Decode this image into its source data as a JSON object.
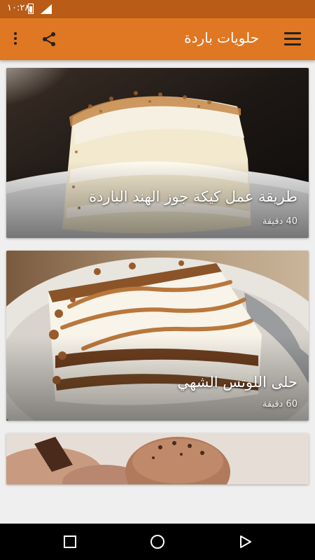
{
  "status_bar": {
    "time": "١٠:٢٨",
    "icons": [
      "battery-icon",
      "signal-icon"
    ]
  },
  "app_bar": {
    "title": "حلويات باردة",
    "icons": [
      "menu-icon",
      "share-icon",
      "more-vert-icon"
    ]
  },
  "recipes": [
    {
      "title": "طريقة عمل كيكة جوز الهند الباردة",
      "time": "40 دقيقة"
    },
    {
      "title": "حلى اللوتس الشهي",
      "time": "60 دقيقة"
    },
    {
      "title": "",
      "time": ""
    }
  ],
  "nav_bar": {
    "icons": [
      "recent-apps-icon",
      "home-icon",
      "back-icon"
    ]
  },
  "colors": {
    "app_bar": "#e07722",
    "status_bar": "#b85c18",
    "background": "#efefef"
  }
}
